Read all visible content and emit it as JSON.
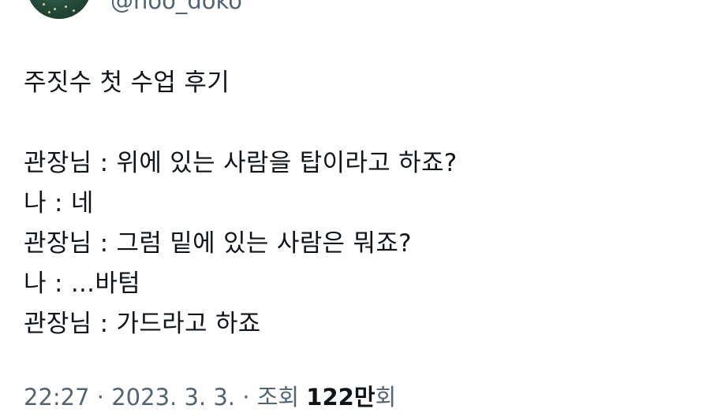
{
  "author": {
    "handle": "@noo_doko"
  },
  "tweet": {
    "title": "주짓수 첫 수업 후기",
    "lines": [
      "관장님 : 위에 있는 사람을 탑이라고 하죠?",
      "나 : 네",
      "관장님 : 그럼 밑에 있는 사람은 뭐죠?",
      "나 : ...바텀",
      "관장님 : 가드라고 하죠"
    ]
  },
  "meta": {
    "time": "22:27",
    "separator": "·",
    "date": "2023. 3. 3.",
    "views_label": "조회",
    "views_count": "122만",
    "views_suffix": "회"
  }
}
